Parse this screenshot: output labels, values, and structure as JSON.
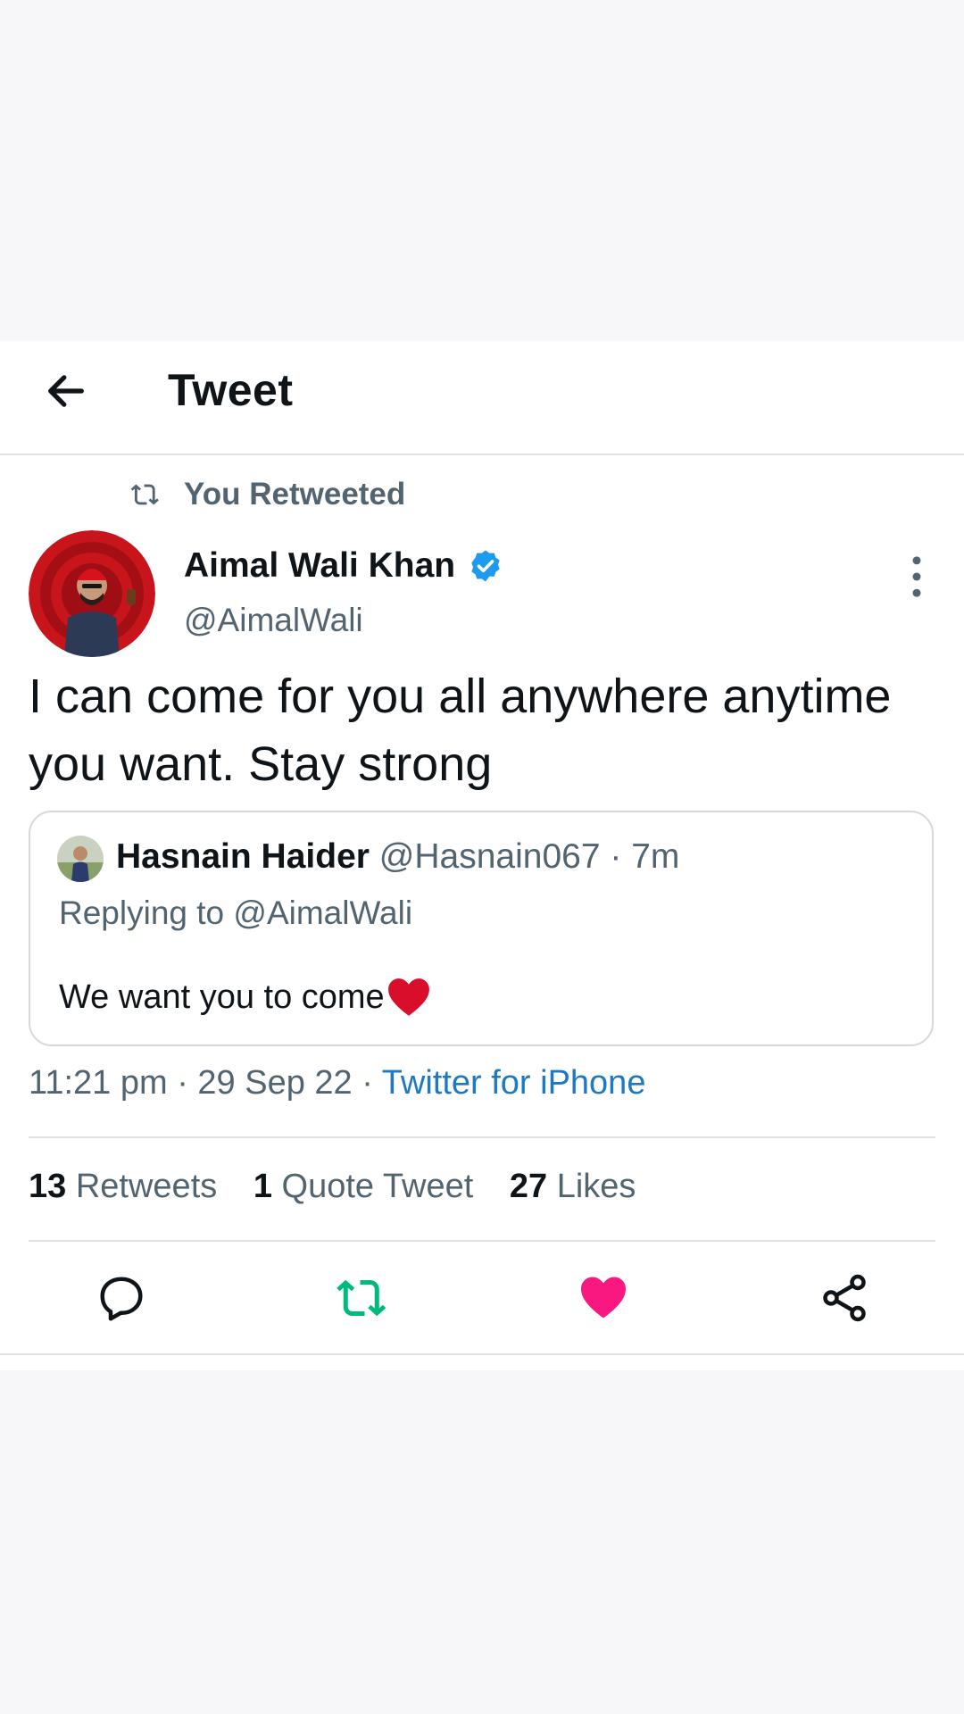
{
  "header": {
    "title": "Tweet"
  },
  "retweet_banner": {
    "label": "You Retweeted"
  },
  "author": {
    "name": "Aimal Wali Khan",
    "handle": "@AimalWali",
    "verified": true
  },
  "tweet": {
    "text": "I can come for you all anywhere anytime you want. Stay strong"
  },
  "quoted_tweet": {
    "name": "Hasnain Haider",
    "handle": "@Hasnain067",
    "separator": "·",
    "time": "7m",
    "replying_to": "Replying to @AimalWali",
    "text": "We want you to come"
  },
  "meta": {
    "time": "11:21 pm",
    "date": "29 Sep 22",
    "source": "Twitter for iPhone"
  },
  "stats": {
    "retweets_count": "13",
    "retweets_label": "Retweets",
    "quotes_count": "1",
    "quotes_label": "Quote Tweet",
    "likes_count": "27",
    "likes_label": "Likes"
  },
  "actions": [
    "reply-icon",
    "retweet-icon",
    "like-icon",
    "share-icon"
  ],
  "colors": {
    "retweet_green": "#00ba7c",
    "like_red": "#f91880",
    "link_blue": "#1d79c4",
    "verified_blue": "#1d9bf0"
  }
}
